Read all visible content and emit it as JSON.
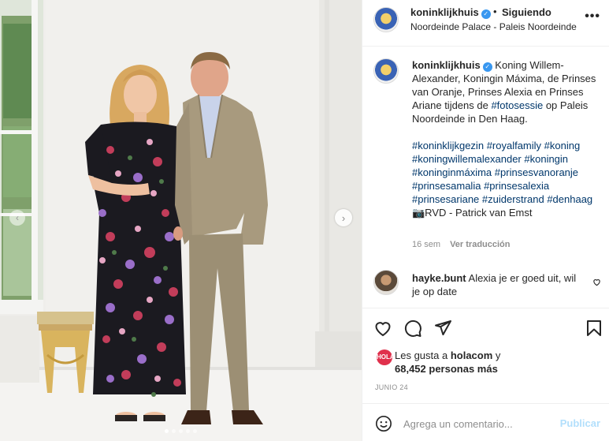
{
  "post": {
    "account": "koninklijkhuis",
    "follow_status": "Siguiendo",
    "bullet": "•",
    "location": "Noordeinde Palace - Paleis Noordeinde",
    "more": "•••"
  },
  "caption": {
    "account": "koninklijkhuis",
    "text_before": " Koning Willem-Alexander, Koningin Máxima, de Prinses van Oranje, Prinses Alexia en Prinses Ariane tijdens de ",
    "text_tag": "#fotosessie",
    "text_after": " op Paleis Noordeinde in Den Haag.",
    "hashtags": [
      "#koninklijkgezin",
      "#royalfamily",
      "#koning",
      "#koningwillemalexander",
      "#koningin",
      "#koninginmáxima",
      "#prinsesvanoranje",
      "#prinsesamalia",
      "#prinsesalexia",
      "#prinsesariane",
      "#zuiderstrand",
      "#denhaag"
    ],
    "credit": "📷RVD - Patrick van Emst",
    "age": "16 sem",
    "translate": "Ver traducción"
  },
  "comment": {
    "user": "hayke.bunt",
    "text": " Alexia je er goed uit, wil je op date"
  },
  "likes": {
    "mini_avatar_text": "HOLA",
    "prefix": "Les gusta a ",
    "user": "holacom",
    "suffix": " y",
    "count": "68,452 personas más"
  },
  "date": "JUNIO 24",
  "add_comment": {
    "placeholder": "Agrega un comentario...",
    "publish": "Publicar"
  },
  "icons": {
    "carousel_next": "chevron-right-icon",
    "carousel_prev": "chevron-left-icon",
    "like": "heart-icon",
    "comment": "comment-icon",
    "share": "paper-plane-icon",
    "save": "bookmark-icon",
    "emoji": "smiley-icon",
    "verified": "verified-badge-icon"
  },
  "carousel": {
    "slides": 5,
    "active": 1
  }
}
